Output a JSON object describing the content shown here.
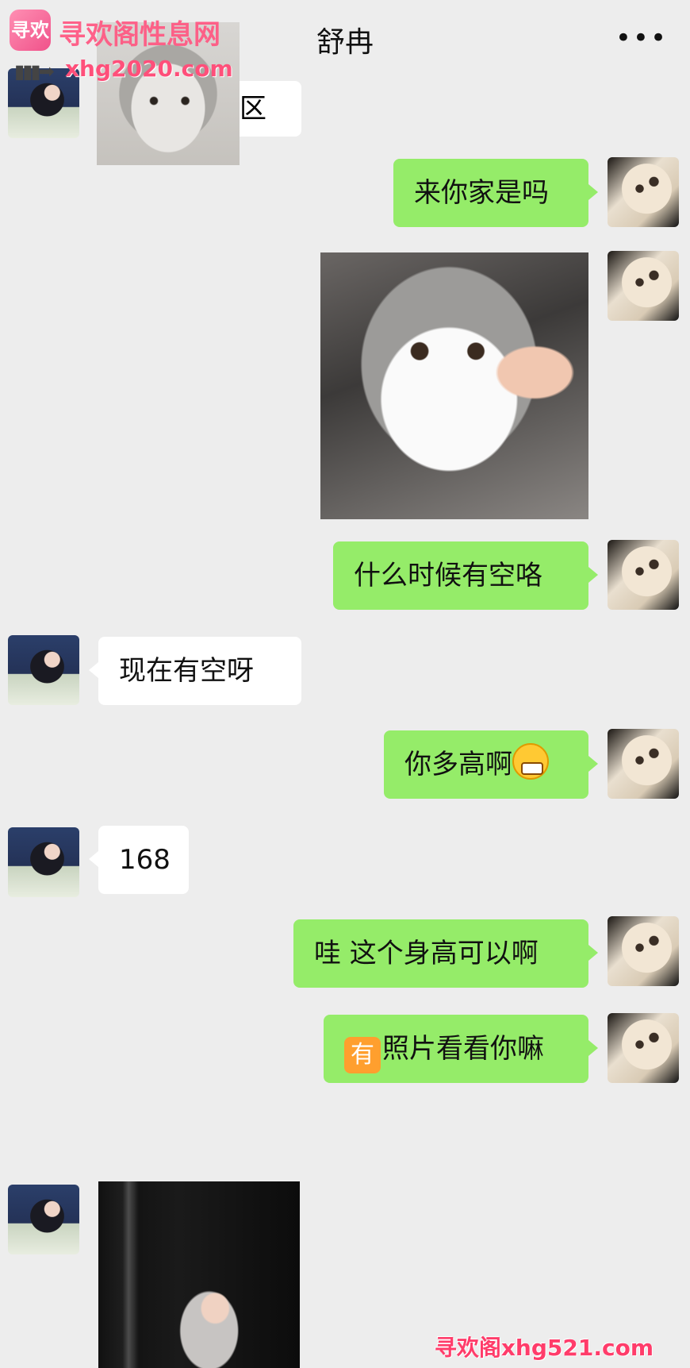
{
  "header": {
    "title": "舒冉",
    "back_icon": "‹",
    "more_icon": "•••"
  },
  "watermark_top": {
    "logo_text": "寻欢",
    "site_name": "寻欢阁性息网",
    "arrow": "▮▮▮➡",
    "domain": "xhg2020.com"
  },
  "watermark_bottom": {
    "text": "寻欢阁xhg521.com"
  },
  "messages": {
    "partial_received": "区",
    "m1": "来你家是吗",
    "m2": "什么时候有空咯",
    "m3": "现在有空呀",
    "m4": "你多高啊",
    "m5": "168",
    "m6": "哇 这个身高可以啊",
    "m7_prefix_emoji": "有",
    "m7": "照片看看你嘛"
  }
}
